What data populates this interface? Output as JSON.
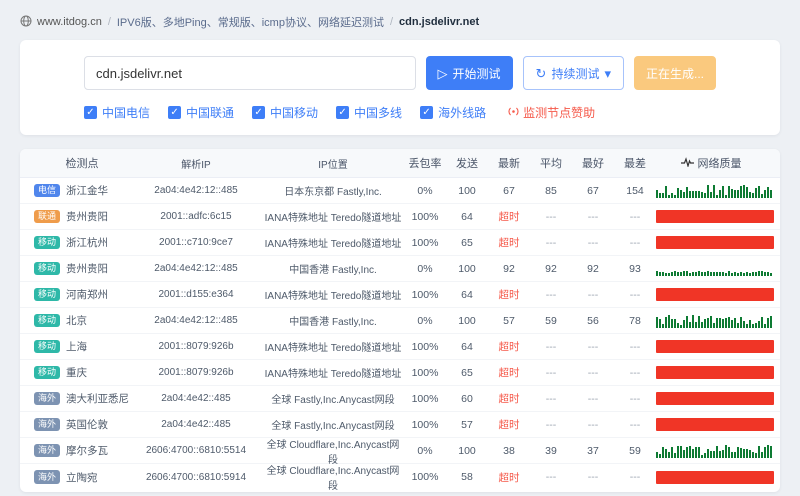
{
  "breadcrumb": {
    "site": "www.itdog.cn",
    "separator": "/",
    "category": "IPV6版、多地Ping、常规版、icmp协议、网络延迟测试",
    "target": "cdn.jsdelivr.net"
  },
  "controls": {
    "input_value": "cdn.jsdelivr.net",
    "start_label": "开始测试",
    "continuous_label": "持续测试",
    "generating_label": "正在生成...",
    "sponsor_label": "监测节点赞助",
    "checkboxes": [
      {
        "label": "中国电信",
        "checked": true
      },
      {
        "label": "中国联通",
        "checked": true
      },
      {
        "label": "中国移动",
        "checked": true
      },
      {
        "label": "中国多线",
        "checked": true
      },
      {
        "label": "海外线路",
        "checked": true
      }
    ]
  },
  "icons": {
    "play": "▷",
    "refresh": "↻",
    "caret_down": "▾",
    "check": "✓",
    "globe": "globe-icon",
    "sponsor": "radar-icon",
    "quality": "pulse-icon"
  },
  "colors": {
    "primary": "#3e7ef7",
    "warning": "#fac97e",
    "timeout_text": "#f5594a",
    "red_bar": "#f03526",
    "green_spark": "#0e7b33",
    "badge_dianxin": "#5086ec",
    "badge_liantong": "#ef9c4b",
    "badge_yidong": "#2eb8a8",
    "badge_haiwai": "#7d93b2"
  },
  "table": {
    "headers": [
      "检测点",
      "解析IP",
      "IP位置",
      "丢包率",
      "发送",
      "最新",
      "平均",
      "最好",
      "最差",
      "网络质量"
    ],
    "rows": [
      {
        "isp": "电信",
        "location": "浙江金华",
        "ip": "2a04:4e42:12::485",
        "ip_location": "日本东京都 Fastly,Inc.",
        "loss": "0%",
        "sent": "100",
        "latest": "67",
        "avg": "85",
        "best": "67",
        "worst": "154",
        "quality": "good"
      },
      {
        "isp": "联通",
        "location": "贵州贵阳",
        "ip": "2001::adfc:6c15",
        "ip_location": "IANA特殊地址 Teredo隧道地址",
        "loss": "100%",
        "sent": "64",
        "latest": "超时",
        "avg": "---",
        "best": "---",
        "worst": "---",
        "quality": "timeout"
      },
      {
        "isp": "移动",
        "location": "浙江杭州",
        "ip": "2001::c710:9ce7",
        "ip_location": "IANA特殊地址 Teredo隧道地址",
        "loss": "100%",
        "sent": "65",
        "latest": "超时",
        "avg": "---",
        "best": "---",
        "worst": "---",
        "quality": "timeout"
      },
      {
        "isp": "移动",
        "location": "贵州贵阳",
        "ip": "2a04:4e42:12::485",
        "ip_location": "中国香港 Fastly,Inc.",
        "loss": "0%",
        "sent": "100",
        "latest": "92",
        "avg": "92",
        "best": "92",
        "worst": "93",
        "quality": "good-flat"
      },
      {
        "isp": "移动",
        "location": "河南郑州",
        "ip": "2001::d155:e364",
        "ip_location": "IANA特殊地址 Teredo隧道地址",
        "loss": "100%",
        "sent": "64",
        "latest": "超时",
        "avg": "---",
        "best": "---",
        "worst": "---",
        "quality": "timeout"
      },
      {
        "isp": "移动",
        "location": "北京",
        "ip": "2a04:4e42:12::485",
        "ip_location": "中国香港 Fastly,Inc.",
        "loss": "0%",
        "sent": "100",
        "latest": "57",
        "avg": "59",
        "best": "56",
        "worst": "78",
        "quality": "good"
      },
      {
        "isp": "移动",
        "location": "上海",
        "ip": "2001::8079:926b",
        "ip_location": "IANA特殊地址 Teredo隧道地址",
        "loss": "100%",
        "sent": "64",
        "latest": "超时",
        "avg": "---",
        "best": "---",
        "worst": "---",
        "quality": "timeout"
      },
      {
        "isp": "移动",
        "location": "重庆",
        "ip": "2001::8079:926b",
        "ip_location": "IANA特殊地址 Teredo隧道地址",
        "loss": "100%",
        "sent": "65",
        "latest": "超时",
        "avg": "---",
        "best": "---",
        "worst": "---",
        "quality": "timeout"
      },
      {
        "isp": "海外",
        "location": "澳大利亚悉尼",
        "ip": "2a04:4e42::485",
        "ip_location": "全球 Fastly,Inc.Anycast网段",
        "loss": "100%",
        "sent": "60",
        "latest": "超时",
        "avg": "---",
        "best": "---",
        "worst": "---",
        "quality": "timeout"
      },
      {
        "isp": "海外",
        "location": "英国伦敦",
        "ip": "2a04:4e42::485",
        "ip_location": "全球 Fastly,Inc.Anycast网段",
        "loss": "100%",
        "sent": "57",
        "latest": "超时",
        "avg": "---",
        "best": "---",
        "worst": "---",
        "quality": "timeout"
      },
      {
        "isp": "海外",
        "location": "摩尔多瓦",
        "ip": "2606:4700::6810:5514",
        "ip_location": "全球 Cloudflare,Inc.Anycast网段",
        "loss": "0%",
        "sent": "100",
        "latest": "38",
        "avg": "39",
        "best": "37",
        "worst": "59",
        "quality": "good"
      },
      {
        "isp": "海外",
        "location": "立陶宛",
        "ip": "2606:4700::6810:5914",
        "ip_location": "全球 Cloudflare,Inc.Anycast网段",
        "loss": "100%",
        "sent": "58",
        "latest": "超时",
        "avg": "---",
        "best": "---",
        "worst": "---",
        "quality": "timeout"
      }
    ]
  }
}
